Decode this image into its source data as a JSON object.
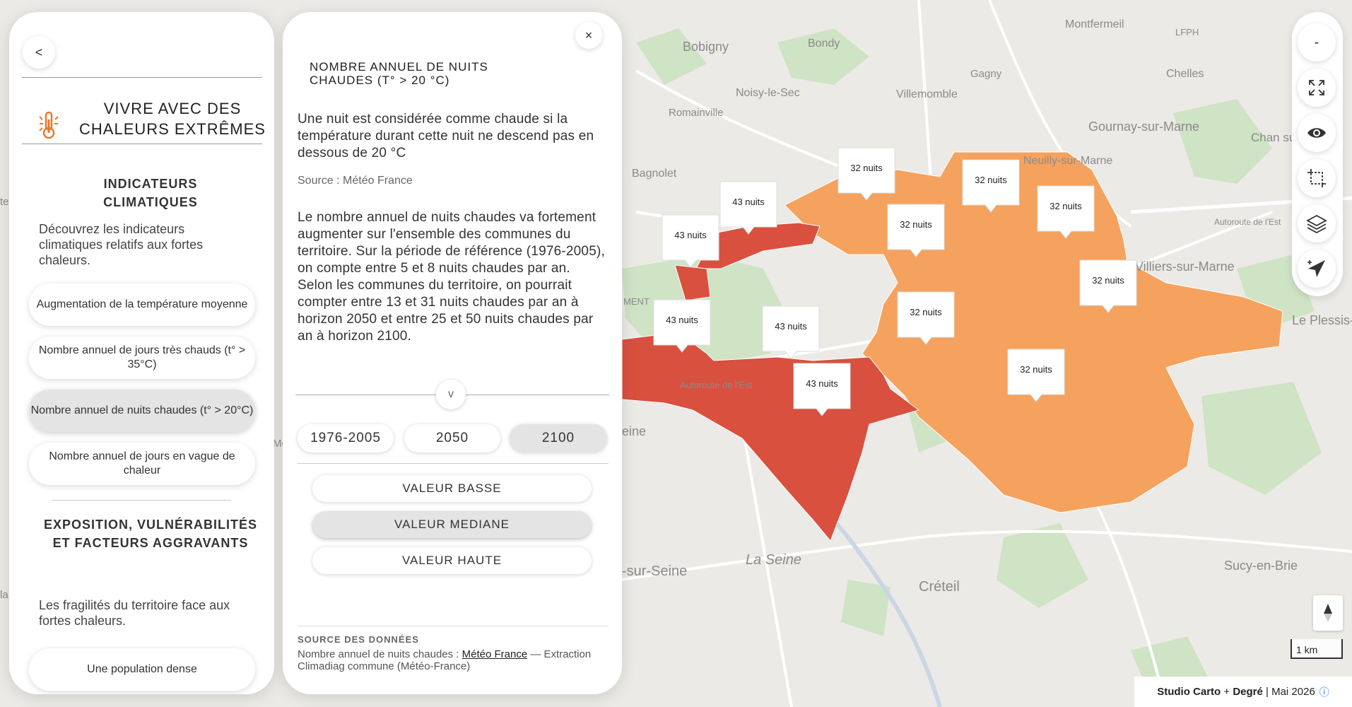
{
  "left_panel": {
    "back_label": "<",
    "title": "VIVRE AVEC DES CHALEURS EXTRÊMES",
    "section1_title": "INDICATEURS CLIMATIQUES",
    "section1_desc": "Découvrez les indicateurs climatiques relatifs aux fortes chaleurs.",
    "buttons": [
      {
        "label": "Augmentation de la température moyenne"
      },
      {
        "label": "Nombre annuel de jours très chauds (t° > 35°C)"
      },
      {
        "label": "Nombre annuel de nuits chaudes (t° > 20°C)",
        "active": true
      },
      {
        "label": "Nombre annuel de jours en vague de chaleur"
      }
    ],
    "section2_title": "EXPOSITION, VULNÉRABILITÉS ET FACTEURS AGGRAVANTS",
    "section2_desc": "Les fragilités du territoire face aux fortes chaleurs.",
    "section2_first_button": "Une population dense"
  },
  "detail": {
    "close_label": "×",
    "title": "NOMBRE ANNUEL DE NUITS CHAUDES (T° > 20 °C)",
    "definition": "Une nuit est considérée comme chaude si la température durant cette nuit ne descend pas en dessous de 20 °C",
    "source_line": "Source : Météo France",
    "body": "Le nombre annuel de nuits chaudes va fortement augmenter sur l'ensemble des communes du territoire. Sur la période de référence (1976-2005), on compte entre 5 et 8 nuits chaudes par an. Selon les communes du territoire, on pourrait compter entre 13 et 31 nuits chaudes par an à horizon 2050 et entre 25 et 50 nuits chaudes par an à horizon 2100.",
    "chevron_label": "v",
    "periods": [
      "1976-2005",
      "2050",
      "2100"
    ],
    "active_period": "2100",
    "values": [
      "VALEUR BASSE",
      "VALEUR MEDIANE",
      "VALEUR HAUTE"
    ],
    "active_value": "VALEUR MEDIANE",
    "data_source_heading": "SOURCE DES DONNÉES",
    "data_source_prefix": "Nombre annuel de nuits chaudes : ",
    "data_source_link": "Météo France",
    "data_source_suffix": " — Extraction Climadiag commune (Météo-France)"
  },
  "map": {
    "place_labels": [
      "Bobigny",
      "Bondy",
      "Montfermeil",
      "LFPH",
      "Gagny",
      "Chelles",
      "Noisy-le-Sec",
      "Villemomble",
      "Romainville",
      "Gournay-sur-Marne",
      "Chan sur-M",
      "Bagnolet",
      "Neuilly-sur-Marne",
      "Autoroute de l'Est",
      "Villiers-sur-Marne",
      "Le Plessis-Trévise",
      "MENT",
      "Autoroute de l'Est",
      "eine",
      "La Seine",
      "-sur-Seine",
      "Créteil",
      "Sucy-en-Brie",
      "te",
      "la",
      "Mc"
    ],
    "callouts": [
      {
        "label": "32 nuits"
      },
      {
        "label": "43 nuits"
      },
      {
        "label": "32 nuits"
      },
      {
        "label": "32 nuits"
      },
      {
        "label": "43 nuits"
      },
      {
        "label": "32 nuits"
      },
      {
        "label": "32 nuits"
      },
      {
        "label": "43 nuits"
      },
      {
        "label": "32 nuits"
      },
      {
        "label": "43 nuits"
      },
      {
        "label": "32 nuits"
      },
      {
        "label": "43 nuits"
      }
    ],
    "colors": {
      "high": "#d9503f",
      "mid": "#f5a25e",
      "park": "#cfe3c5",
      "background": "#eceae6",
      "road": "#ffffff"
    }
  },
  "toolbar": {
    "zoom_out": "-",
    "icons": [
      "expand-icon",
      "eye-icon",
      "selection-icon",
      "layers-icon",
      "locate-icon"
    ]
  },
  "scale_label": "1 km",
  "credits": {
    "studio": "Studio Carto",
    "plus": " + ",
    "degre": "Degré",
    "date": " | Mai 2026",
    "info": "ⓘ"
  }
}
